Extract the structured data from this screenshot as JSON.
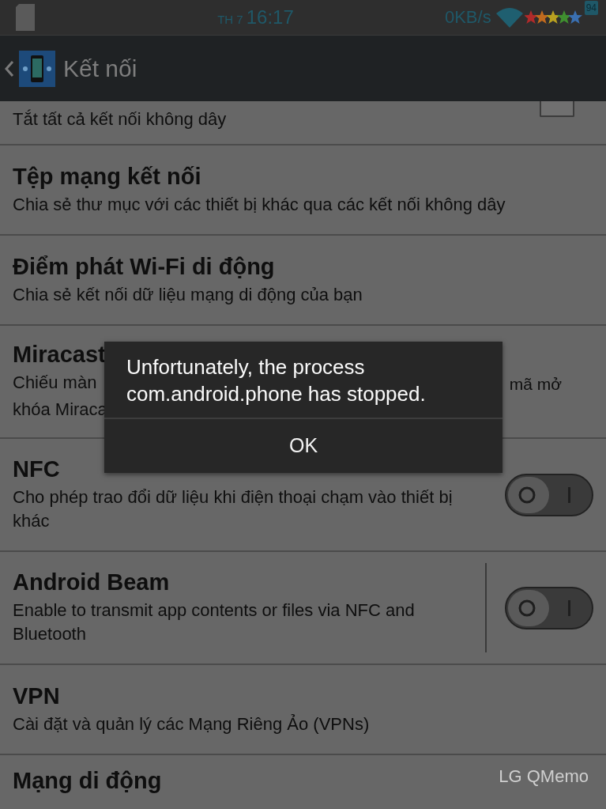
{
  "status_bar": {
    "day": "TH 7",
    "time": "16:17",
    "speed": "0KB/s",
    "battery": "94"
  },
  "action_bar": {
    "title": "Kết nối"
  },
  "settings": [
    {
      "kind": "checkbox",
      "description": "Tắt tất cả kết nối không dây",
      "checked": false
    },
    {
      "kind": "plain",
      "title": "Tệp mạng kết nối",
      "description": "Chia sẻ thư mục với các thiết bị khác qua các kết nối không dây"
    },
    {
      "kind": "plain",
      "title": "Điểm phát Wi-Fi di động",
      "description": "Chia sẻ kết nối dữ liệu mạng di động của bạn"
    },
    {
      "kind": "covered",
      "title": "Miracast",
      "description_left": [
        "Chiếu màn",
        "khóa Miraca"
      ],
      "description_right": "mã mở"
    },
    {
      "kind": "toggle",
      "title": "NFC",
      "description": "Cho phép trao đổi dữ liệu khi điện thoại chạm vào thiết bị khác",
      "on": false
    },
    {
      "kind": "split_toggle",
      "title": "Android Beam",
      "description": "Enable to transmit app contents or files via NFC and Bluetooth",
      "on": false
    },
    {
      "kind": "plain",
      "title": "VPN",
      "description": "Cài đặt và quản lý các Mạng Riêng Ảo (VPNs)"
    },
    {
      "kind": "plain",
      "title": "Mạng di động"
    }
  ],
  "dialog": {
    "message": "Unfortunately, the process com.android.phone has stopped.",
    "button": "OK"
  },
  "floating_label": "LG QMemo"
}
